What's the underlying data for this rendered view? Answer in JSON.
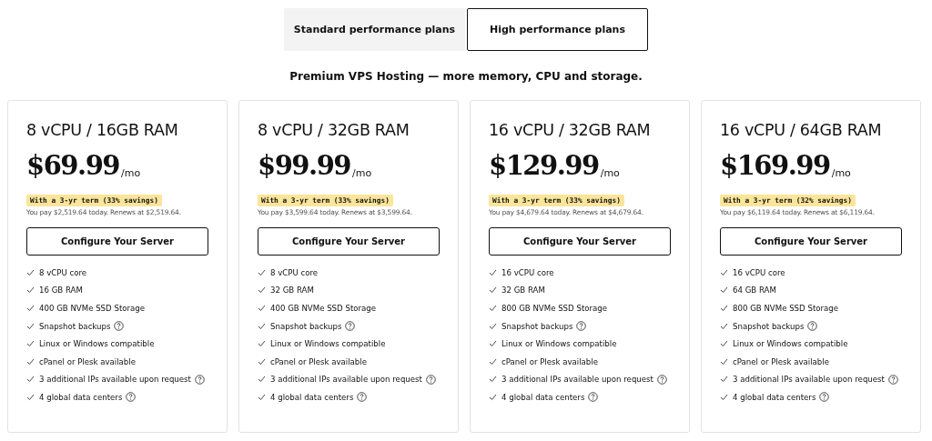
{
  "tabs": [
    {
      "label": "Standard performance plans",
      "selected": false
    },
    {
      "label": "High performance plans",
      "selected": true
    }
  ],
  "subtitle": "Premium VPS Hosting — more memory, CPU and storage.",
  "plans": [
    {
      "name": "8 vCPU / 16GB RAM",
      "price": "$69.99",
      "unit": "/mo",
      "term": "With a 3-yr term (33% savings)",
      "note": "You pay $2,519.64 today. Renews at $2,519.64.",
      "button": "Configure Your Server",
      "features": [
        {
          "text": "8 vCPU core",
          "info": false
        },
        {
          "text": "16 GB RAM",
          "info": false
        },
        {
          "text": "400 GB NVMe SSD Storage",
          "info": false
        },
        {
          "text": "Snapshot backups",
          "info": true
        },
        {
          "text": "Linux or Windows compatible",
          "info": false
        },
        {
          "text": "cPanel or Plesk available",
          "info": false
        },
        {
          "text": "3 additional IPs available upon request",
          "info": true
        },
        {
          "text": "4 global data centers",
          "info": true
        }
      ]
    },
    {
      "name": "8 vCPU / 32GB RAM",
      "price": "$99.99",
      "unit": "/mo",
      "term": "With a 3-yr term (33% savings)",
      "note": "You pay $3,599.64 today. Renews at $3,599.64.",
      "button": "Configure Your Server",
      "features": [
        {
          "text": "8 vCPU core",
          "info": false
        },
        {
          "text": "32 GB RAM",
          "info": false
        },
        {
          "text": "400 GB NVMe SSD Storage",
          "info": false
        },
        {
          "text": "Snapshot backups",
          "info": true
        },
        {
          "text": "Linux or Windows compatible",
          "info": false
        },
        {
          "text": "cPanel or Plesk available",
          "info": false
        },
        {
          "text": "3 additional IPs available upon request",
          "info": true
        },
        {
          "text": "4 global data centers",
          "info": true
        }
      ]
    },
    {
      "name": "16 vCPU / 32GB RAM",
      "price": "$129.99",
      "unit": "/mo",
      "term": "With a 3-yr term (33% savings)",
      "note": "You pay $4,679.64 today. Renews at $4,679.64.",
      "button": "Configure Your Server",
      "features": [
        {
          "text": "16 vCPU core",
          "info": false
        },
        {
          "text": "32 GB RAM",
          "info": false
        },
        {
          "text": "800 GB NVMe SSD Storage",
          "info": false
        },
        {
          "text": "Snapshot backups",
          "info": true
        },
        {
          "text": "Linux or Windows compatible",
          "info": false
        },
        {
          "text": "cPanel or Plesk available",
          "info": false
        },
        {
          "text": "3 additional IPs available upon request",
          "info": true
        },
        {
          "text": "4 global data centers",
          "info": true
        }
      ]
    },
    {
      "name": "16 vCPU / 64GB RAM",
      "price": "$169.99",
      "unit": "/mo",
      "term": "With a 3-yr term (32% savings)",
      "note": "You pay $6,119.64 today. Renews at $6,119.64.",
      "button": "Configure Your Server",
      "features": [
        {
          "text": "16 vCPU core",
          "info": false
        },
        {
          "text": "64 GB RAM",
          "info": false
        },
        {
          "text": "800 GB NVMe SSD Storage",
          "info": false
        },
        {
          "text": "Snapshot backups",
          "info": true
        },
        {
          "text": "Linux or Windows compatible",
          "info": false
        },
        {
          "text": "cPanel or Plesk available",
          "info": false
        },
        {
          "text": "3 additional IPs available upon request",
          "info": true
        },
        {
          "text": "4 global data centers",
          "info": true
        }
      ]
    }
  ]
}
